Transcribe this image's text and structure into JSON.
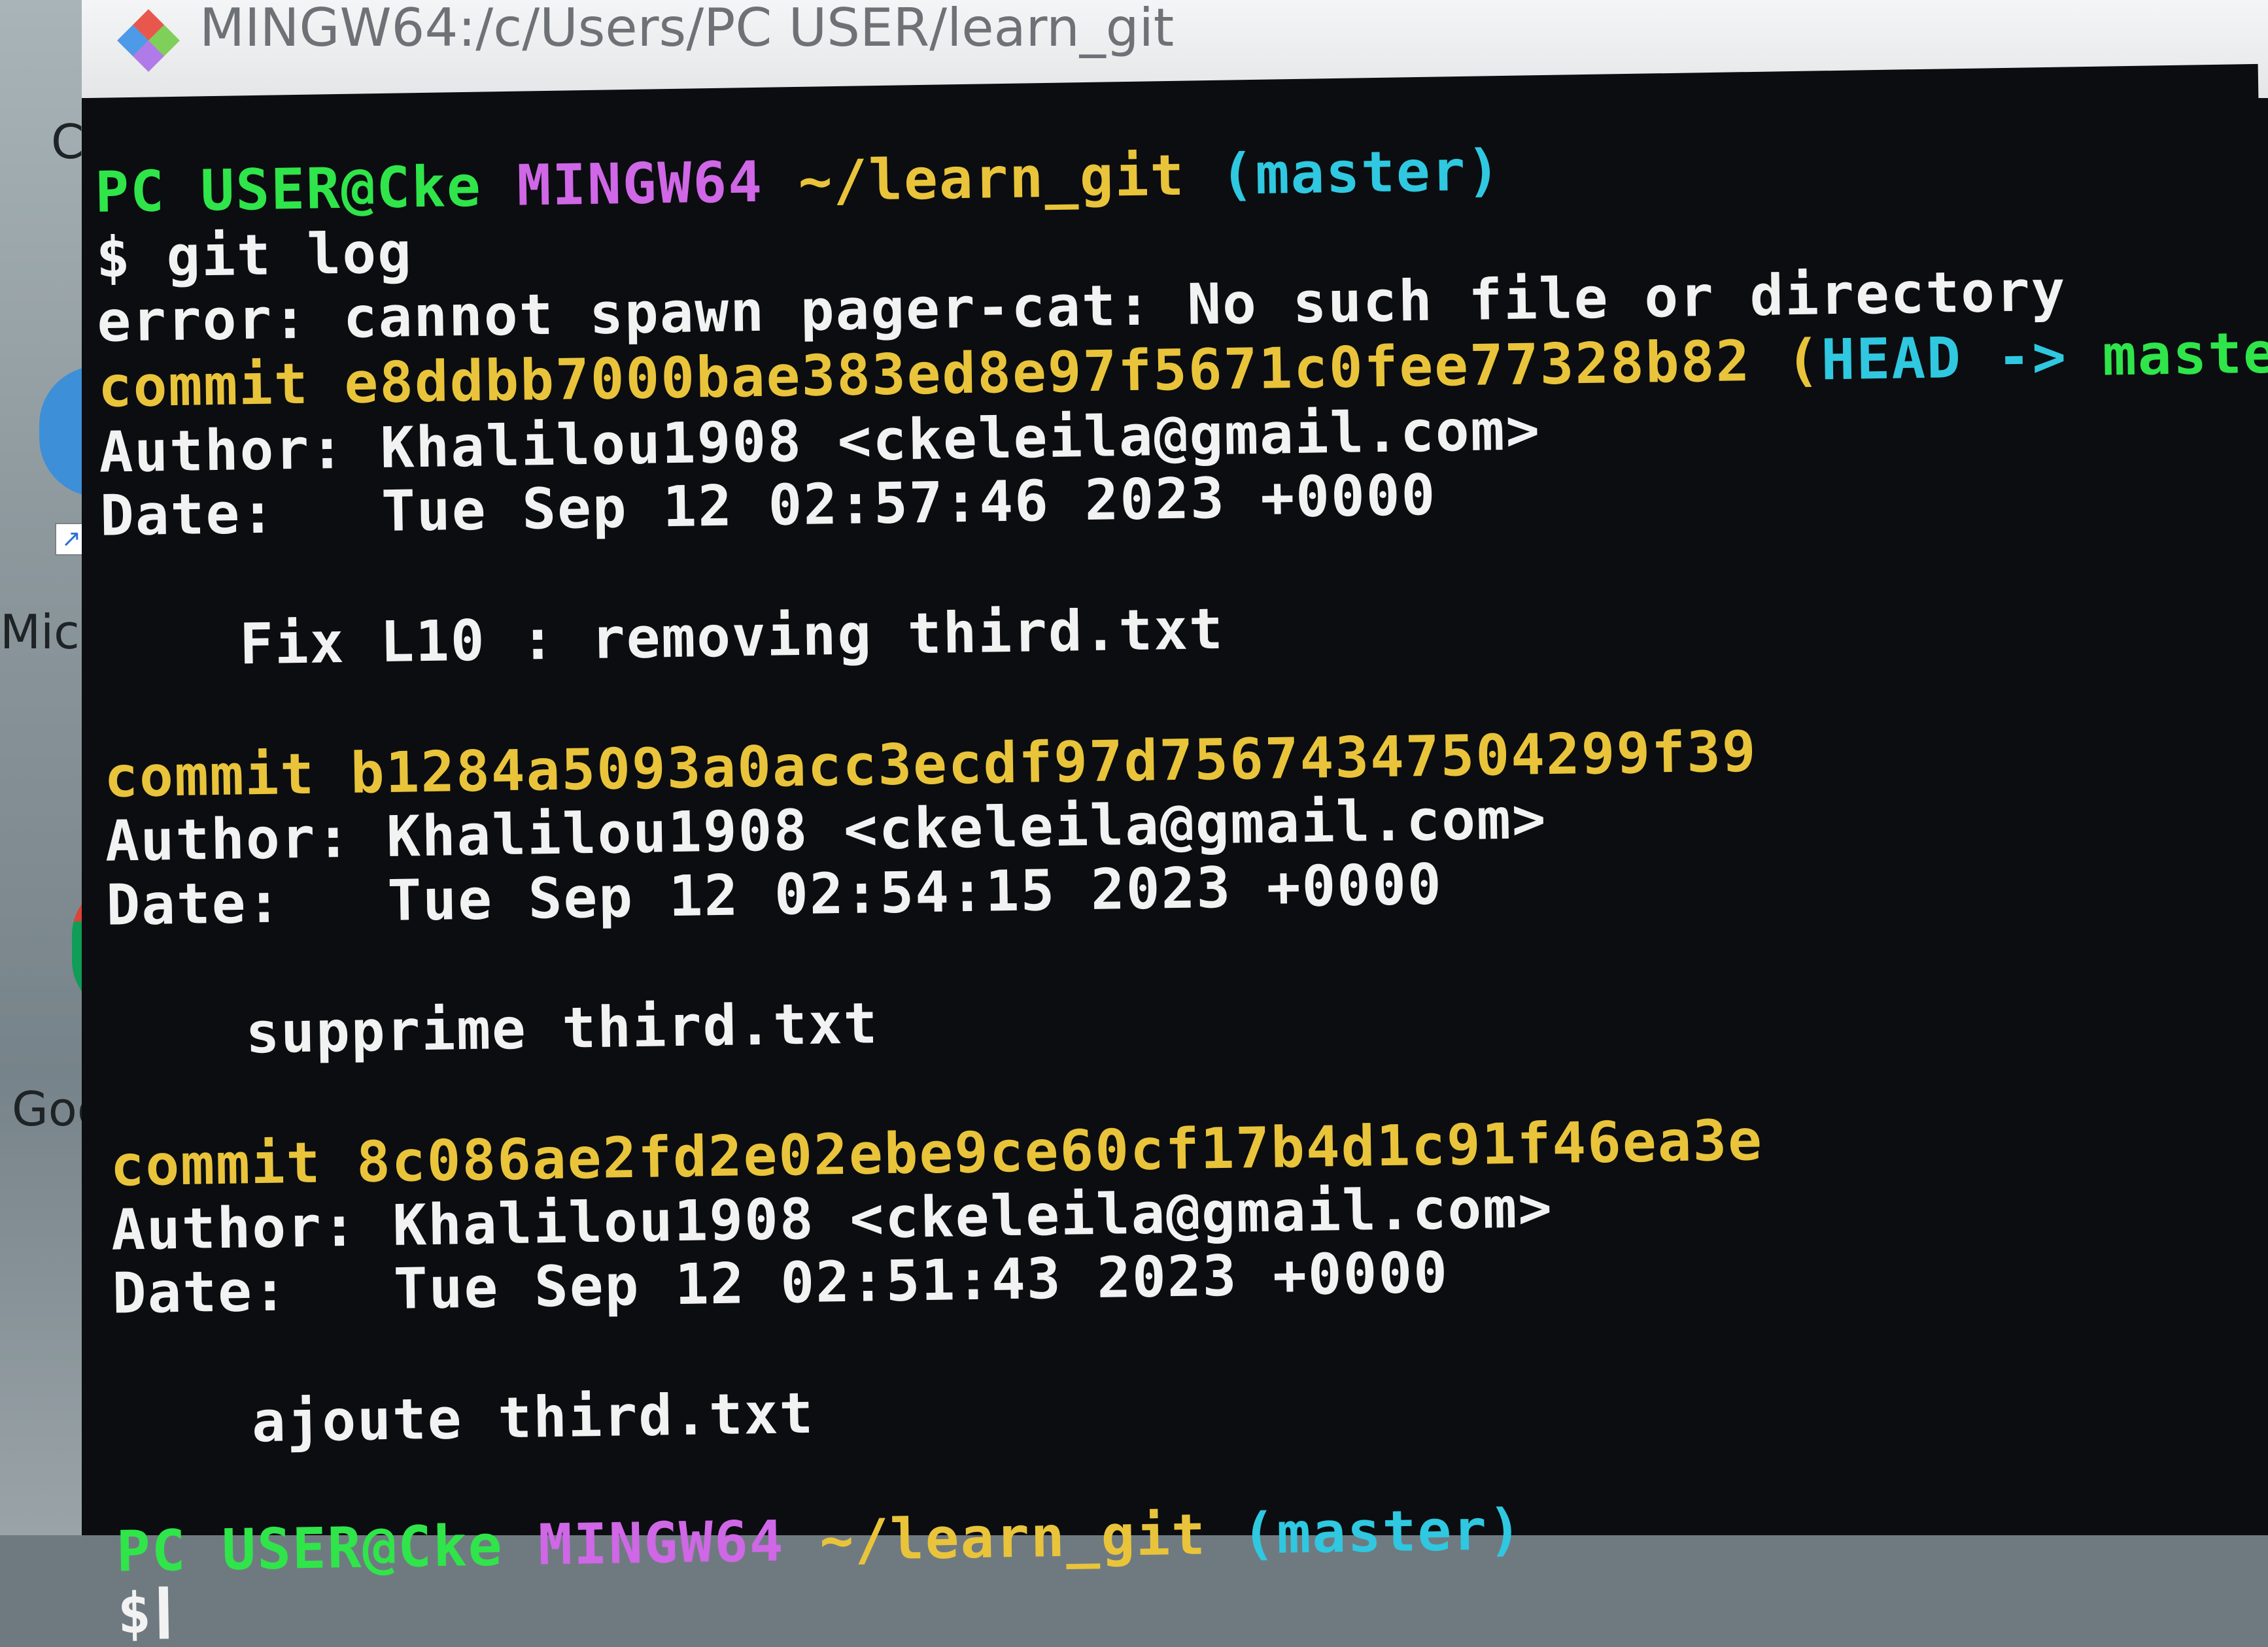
{
  "window": {
    "title": "MINGW64:/c/Users/PC USER/learn_git"
  },
  "desktop": {
    "labels": [
      "C",
      "Micr",
      "Goo"
    ]
  },
  "prompt1": {
    "user_host": "PC USER@Cke",
    "shell": "MINGW64",
    "path": "~/learn_git",
    "branch": "(master)"
  },
  "command": {
    "text": "$ git log"
  },
  "error": {
    "text": "error: cannot spawn pager-cat: No such file or directory"
  },
  "commits": [
    {
      "label": "commit",
      "hash": "e8ddbb7000bae383ed8e97f5671c0fee77328b82",
      "ref_open": "(",
      "ref_head": "HEAD ->",
      "ref_branch": "master",
      "ref_close": ")",
      "author": "Author: Khalilou1908 <ckeleila@gmail.com>",
      "date": "Date:   Tue Sep 12 02:57:46 2023 +0000",
      "message": "Fix L10 : removing third.txt"
    },
    {
      "label": "commit",
      "hash": "b1284a5093a0acc3ecdf97d75674347504299f39",
      "author": "Author: Khalilou1908 <ckeleila@gmail.com>",
      "date": "Date:   Tue Sep 12 02:54:15 2023 +0000",
      "message": "supprime third.txt"
    },
    {
      "label": "commit",
      "hash": "8c086ae2fd2e02ebe9ce60cf17b4d1c91f46ea3e",
      "author": "Author: Khalilou1908 <ckeleila@gmail.com>",
      "date": "Date:   Tue Sep 12 02:51:43 2023 +0000",
      "message": "ajoute third.txt"
    }
  ],
  "prompt2": {
    "user_host": "PC USER@Cke",
    "shell": "MINGW64",
    "path": "~/learn_git",
    "branch": "(master)",
    "input": "$"
  },
  "colors": {
    "prompt_user": "#2fe54a",
    "prompt_shell": "#cf67e6",
    "prompt_path": "#e9c43b",
    "prompt_branch": "#2fc8e0",
    "commit_hash": "#e9c43b",
    "ref_head": "#2fc8e0",
    "ref_branch": "#2fe54a",
    "background": "#0b0d10",
    "text": "#ececec"
  },
  "icons": {
    "title_icon": "git-bash-icon",
    "cursor": "text-cursor"
  }
}
